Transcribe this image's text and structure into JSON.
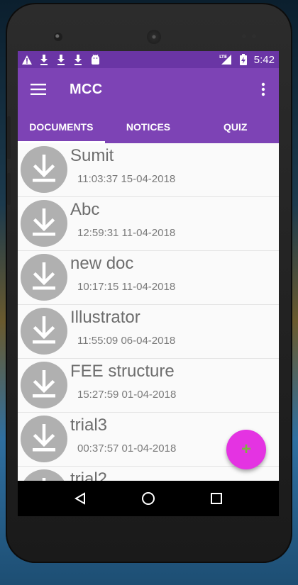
{
  "status_bar": {
    "icons": [
      "warning-icon",
      "download-icon",
      "download-icon",
      "download-icon",
      "android-icon"
    ],
    "network": "LTE",
    "time": "5:42"
  },
  "app_bar": {
    "title": "MCC",
    "menu_icon": "menu-icon",
    "overflow_icon": "more-vert-icon"
  },
  "tabs": [
    {
      "label": "DOCUMENTS",
      "active": true
    },
    {
      "label": "NOTICES",
      "active": false
    },
    {
      "label": "QUIZ",
      "active": false
    }
  ],
  "documents": [
    {
      "name": "Sumit",
      "timestamp": "11:03:37 15-04-2018"
    },
    {
      "name": "Abc",
      "timestamp": "12:59:31 11-04-2018"
    },
    {
      "name": "new doc",
      "timestamp": "10:17:15 11-04-2018"
    },
    {
      "name": "Illustrator",
      "timestamp": "11:55:09 06-04-2018"
    },
    {
      "name": "FEE structure",
      "timestamp": "15:27:59 01-04-2018"
    },
    {
      "name": "trial3",
      "timestamp": "00:37:57 01-04-2018"
    },
    {
      "name": "trial2",
      "timestamp": ""
    }
  ],
  "fab": {
    "label": "+",
    "icon": "add-icon"
  },
  "colors": {
    "primary": "#7d43b5",
    "status_bar": "#6a35a5",
    "fab": "#e433e2",
    "avatar": "#b0b0b0"
  }
}
